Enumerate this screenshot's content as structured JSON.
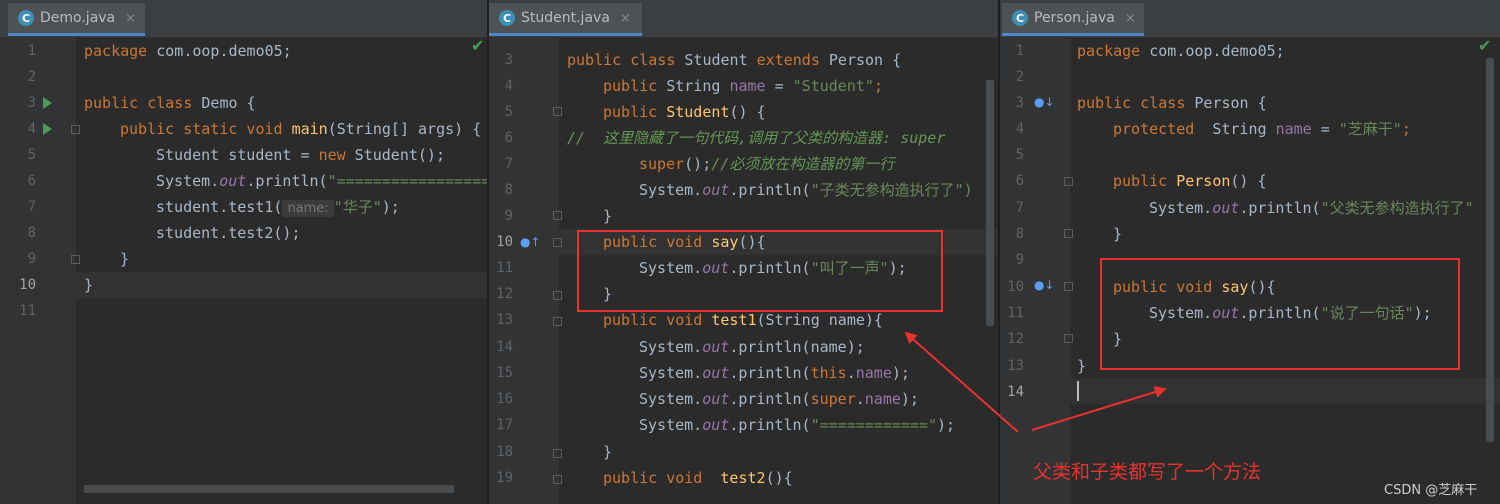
{
  "tabs": {
    "demo": {
      "label": "Demo.java",
      "close": "×",
      "icon": "java-class-icon"
    },
    "student": {
      "label": "Student.java",
      "close": "×",
      "icon": "java-class-icon"
    },
    "person": {
      "label": "Person.java",
      "close": "×",
      "icon": "java-class-icon"
    }
  },
  "demo": {
    "line_numbers": [
      "1",
      "2",
      "3",
      "4",
      "5",
      "6",
      "7",
      "8",
      "9",
      "10",
      "11"
    ],
    "code": {
      "l1_kw": "package",
      "l1_rest": " com.oop.demo05;",
      "l3_kw": "public class",
      "l3_rest": " Demo {",
      "l4_kw": "public static void",
      "l4_fn": "main",
      "l4_rest": "(String[] args) {",
      "l5_a": "Student student = ",
      "l5_kw": "new",
      "l5_b": " Student();",
      "l6_a": "System.",
      "l6_it": "out",
      "l6_b": ".println(",
      "l6_str": "\"==================",
      "l7_a": "student.test1(",
      "l7_hint": "name:",
      "l7_str": "\"华子\"",
      "l7_b": ");",
      "l8": "student.test2();",
      "l9": "}",
      "l10": "}"
    }
  },
  "student": {
    "line_numbers": [
      "3",
      "4",
      "5",
      "6",
      "7",
      "8",
      "9",
      "10",
      "11",
      "12",
      "13",
      "14",
      "15",
      "16",
      "17",
      "18",
      "19"
    ],
    "code": {
      "l3_kw": "public class",
      "l3_a": " Student ",
      "l3_kw2": "extends",
      "l3_b": " Person {",
      "l4_kw": "public",
      "l4_a": " String ",
      "l4_fld": "name",
      "l4_b": " = ",
      "l4_str": "\"Student\"",
      "l4_c": ";",
      "l5_kw": "public",
      "l5_fn": "Student",
      "l5_a": "() {",
      "l6_cm": "//  这里隐藏了一句代码,调用了父类的构造器: super",
      "l7_kw": "super",
      "l7_a": "();",
      "l7_cm": "//必须放在构造器的第一行",
      "l8_a": "System.",
      "l8_it": "out",
      "l8_b": ".println(",
      "l8_str": "\"子类无参构造执行了\")",
      "l9": "}",
      "l10_kw": "public void",
      "l10_fn": "say",
      "l10_a": "(){",
      "l11_a": "System.",
      "l11_it": "out",
      "l11_b": ".println(",
      "l11_str": "\"叫了一声\"",
      "l11_c": ");",
      "l12": "}",
      "l13_kw": "public void",
      "l13_fn": "test1",
      "l13_a": "(String name){",
      "l14_a": "System.",
      "l14_it": "out",
      "l14_b": ".println(name);",
      "l15_a": "System.",
      "l15_it": "out",
      "l15_b": ".println(",
      "l15_kw": "this",
      "l15_c": ".",
      "l15_fld": "name",
      "l15_d": ");",
      "l16_a": "System.",
      "l16_it": "out",
      "l16_b": ".println(",
      "l16_kw": "super",
      "l16_c": ".",
      "l16_fld": "name",
      "l16_d": ");",
      "l17_a": "System.",
      "l17_it": "out",
      "l17_b": ".println(",
      "l17_str": "\"============\"",
      "l17_c": ");",
      "l18": "}",
      "l19_kw": "public void",
      "l19_fn": "test2",
      "l19_a": "(){"
    }
  },
  "person": {
    "line_numbers": [
      "1",
      "2",
      "3",
      "4",
      "5",
      "6",
      "7",
      "8",
      "9",
      "10",
      "11",
      "12",
      "13",
      "14"
    ],
    "code": {
      "l1_kw": "package",
      "l1_rest": " com.oop.demo05;",
      "l3_kw": "public class",
      "l3_rest": " Person {",
      "l4_kw": "protected",
      "l4_a": "  String ",
      "l4_fld": "name",
      "l4_b": " = ",
      "l4_str": "\"芝麻干\"",
      "l4_c": ";",
      "l6_kw": "public",
      "l6_fn": "Person",
      "l6_a": "() {",
      "l7_a": "System.",
      "l7_it": "out",
      "l7_b": ".println(",
      "l7_str": "\"父类无参构造执行了\"",
      "l8": "}",
      "l10_kw": "public void",
      "l10_fn": "say",
      "l10_a": "(){",
      "l11_a": "System.",
      "l11_it": "out",
      "l11_b": ".println(",
      "l11_str": "\"说了一句话\"",
      "l11_c": ");",
      "l12": "}",
      "l13": "}"
    }
  },
  "annotation": {
    "text": "父类和子类都写了一个方法"
  },
  "watermark": {
    "text": "CSDN @芝麻干"
  },
  "colors": {
    "keyword": "#cc7832",
    "string": "#6a8759",
    "field": "#9876aa",
    "method": "#ffc66d",
    "comment": "#629755",
    "annotation": "#e8322e"
  }
}
